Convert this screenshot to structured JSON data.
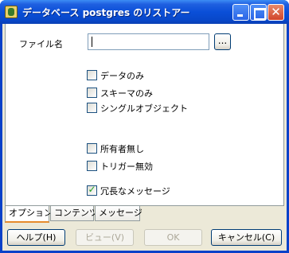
{
  "window": {
    "title": "データベース postgres のリストアー"
  },
  "titlebar_buttons": {
    "minimize_icon": "minimize-icon",
    "maximize_icon": "maximize-icon",
    "close_glyph": "✕"
  },
  "form": {
    "filename_label": "ファイル名",
    "filename_value": "",
    "browse_label": "..."
  },
  "checkboxes": [
    {
      "label": "データのみ",
      "checked": false
    },
    {
      "label": "スキーマのみ",
      "checked": false
    },
    {
      "label": "シングルオブジェクト",
      "checked": false
    },
    {
      "label": "所有者無し",
      "checked": false
    },
    {
      "label": "トリガー無効",
      "checked": false
    },
    {
      "label": "冗長なメッセージ",
      "checked": true,
      "check_glyph": "✓"
    }
  ],
  "tabs": [
    {
      "label": "オプション",
      "active": true
    },
    {
      "label": "コンテンツ",
      "active": false
    },
    {
      "label": "メッセージ",
      "active": false
    }
  ],
  "buttons": {
    "help": "ヘルプ(H)",
    "view": "ビュー(V)",
    "ok": "OK",
    "cancel": "キャンセル(C)"
  },
  "colors": {
    "titlebar": "#0a4fd8",
    "dialog_bg": "#ece9d8",
    "active_tab_accent": "#e68b2c",
    "check": "#21a121"
  }
}
